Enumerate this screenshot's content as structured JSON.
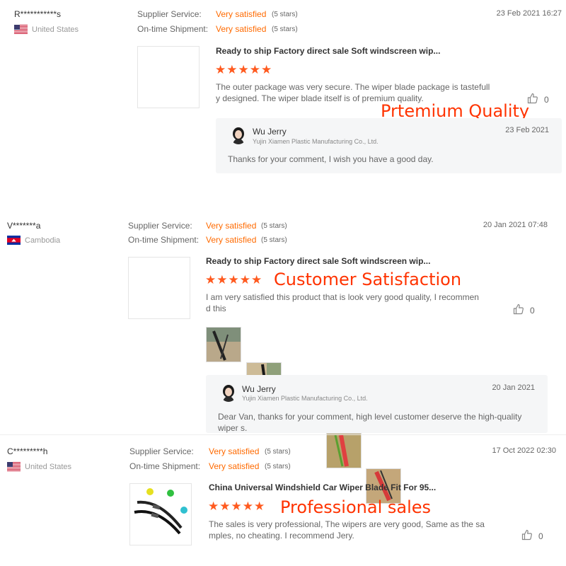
{
  "reviews": [
    {
      "user": "R***********s",
      "country": "United States",
      "supplier_label": "Supplier Service:",
      "supplier_value": "Very satisfied",
      "supplier_stars": "(5 stars)",
      "shipment_label": "On-time Shipment:",
      "shipment_value": "Very satisfied",
      "shipment_stars": "(5 stars)",
      "date": "23 Feb 2021 16:27",
      "product_title": "Ready to ship Factory direct sale Soft windscreen wip...",
      "rating": 5,
      "text": "The outer package was very secure.  The wiper blade package is tastefull y designed.  The wiper blade itself is of premium quality.",
      "likes": "0",
      "overlay": "Prtemium Quality",
      "reply": {
        "name": "Wu Jerry",
        "company": "Yujin Xiamen Plastic Manufacturing Co., Ltd.",
        "date": "23 Feb 2021",
        "text": "Thanks for your comment, I wish you have a good day."
      }
    },
    {
      "user": "V*******a",
      "country": "Cambodia",
      "supplier_label": "Supplier Service:",
      "supplier_value": "Very satisfied",
      "supplier_stars": "(5 stars)",
      "shipment_label": "On-time Shipment:",
      "shipment_value": "Very satisfied",
      "shipment_stars": "(5 stars)",
      "date": "20 Jan 2021 07:48",
      "product_title": "Ready to ship Factory direct sale Soft windscreen wip...",
      "rating": 5,
      "text": "I am very satisfied this product that is look very good quality, I recommen d this",
      "likes": "0",
      "overlay": "Customer Satisfaction",
      "reply": {
        "name": "Wu Jerry",
        "company": "Yujin Xiamen Plastic Manufacturing Co., Ltd.",
        "date": "20 Jan 2021",
        "text": "Dear Van, thanks for your comment, high level customer deserve the high-quality wiper s."
      }
    },
    {
      "user": "C*********h",
      "country": "United States",
      "supplier_label": "Supplier Service:",
      "supplier_value": "Very satisfied",
      "supplier_stars": "(5 stars)",
      "shipment_label": "On-time Shipment:",
      "shipment_value": "Very satisfied",
      "shipment_stars": "(5 stars)",
      "date": "17 Oct 2022 02:30",
      "product_title": "China Universal Windshield Car Wiper Blade Fit For 95...",
      "rating": 5,
      "text": "The sales is very professional, The wipers are very good, Same as the sa mples, no cheating. I recommend Jery.",
      "likes": "0",
      "overlay": "Professional sales"
    }
  ],
  "stars_glyph": "★★★★★",
  "colors": {
    "accent": "#ff6a00",
    "overlay": "#ff3300",
    "reply_bg": "#f5f6f7"
  },
  "icons": {
    "like": "thumbs-up-icon",
    "flag_us": "us-flag-icon",
    "flag_kh": "cambodia-flag-icon"
  }
}
